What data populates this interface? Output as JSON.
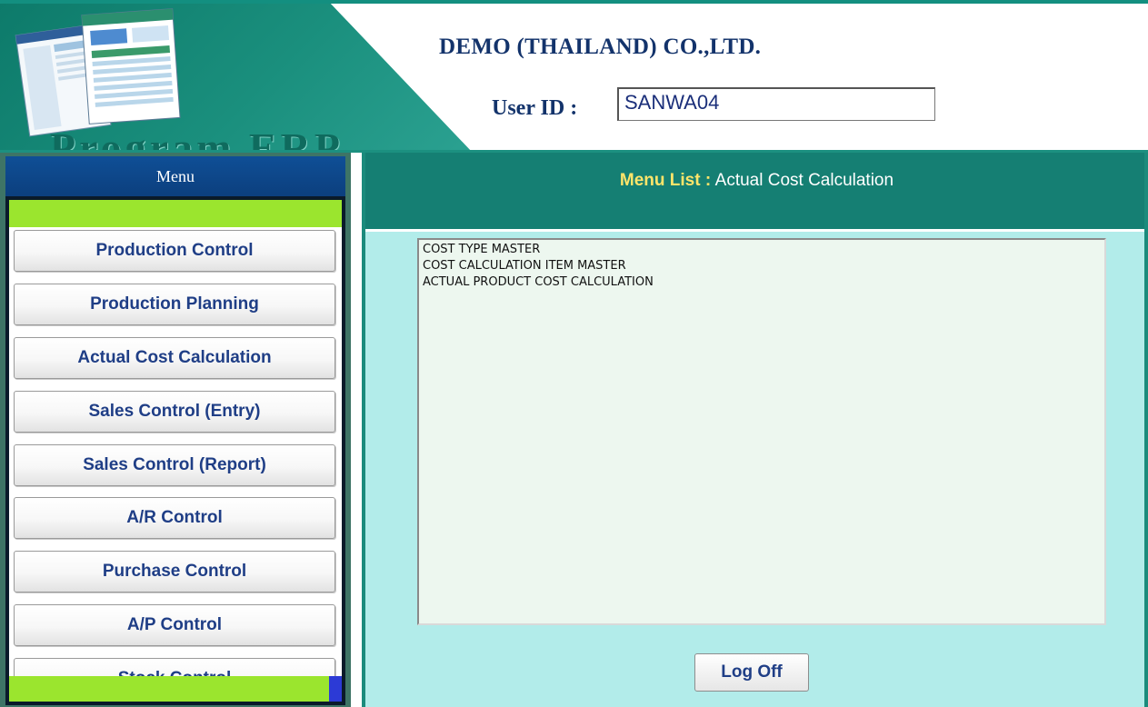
{
  "header": {
    "company_name": "DEMO (THAILAND) CO.,LTD.",
    "userid_label": "User ID :",
    "userid_value": "SANWA04",
    "logo_text": "Program ERP"
  },
  "menu": {
    "title": "Menu",
    "items": [
      {
        "label": "Production Control"
      },
      {
        "label": "Production Planning"
      },
      {
        "label": "Actual Cost Calculation"
      },
      {
        "label": "Sales Control (Entry)"
      },
      {
        "label": "Sales Control (Report)"
      },
      {
        "label": "A/R Control"
      },
      {
        "label": "Purchase Control"
      },
      {
        "label": "A/P Control"
      },
      {
        "label": "Stock Control"
      }
    ]
  },
  "content": {
    "menu_list_label": "Menu List :",
    "menu_list_value": "Actual Cost Calculation",
    "list_items": [
      "COST TYPE MASTER",
      "COST CALCULATION ITEM MASTER",
      "ACTUAL PRODUCT COST CALCULATION"
    ],
    "logoff_label": "Log Off"
  },
  "colors": {
    "header_green": "#1a8f7d",
    "menu_title_blue": "#0f4f96",
    "menu_accent_green": "#9be52e",
    "content_bg": "#b2ecea",
    "menu_list_bar": "#157f73",
    "heading_yellow": "#ffe56a",
    "button_text": "#1f3e86"
  }
}
